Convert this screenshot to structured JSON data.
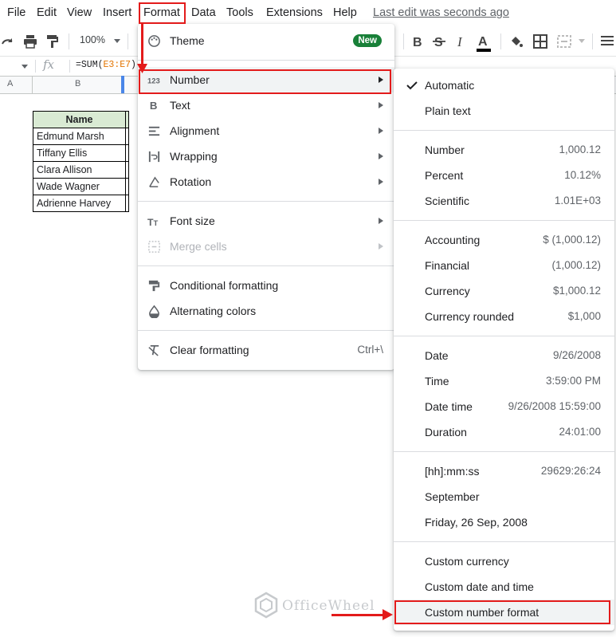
{
  "menubar": {
    "items": [
      "File",
      "Edit",
      "View",
      "Insert",
      "Format",
      "Data",
      "Tools",
      "Extensions",
      "Help"
    ],
    "last_edit": "Last edit was seconds ago"
  },
  "toolbar": {
    "zoom": "100%",
    "icons": [
      "redo-icon",
      "print-icon",
      "paint-format-icon",
      "bold-icon",
      "strikethrough-icon",
      "text-color-icon",
      "fill-color-icon",
      "borders-icon",
      "merge-cells-icon",
      "align-icon"
    ]
  },
  "formula_bar": {
    "fx": "fx",
    "prefix": "=SUM(",
    "ref": "E3:E7",
    "suffix": ")"
  },
  "columns": [
    "A",
    "B"
  ],
  "sheet": {
    "header": "Name",
    "rows": [
      "Edmund Marsh",
      "Tiffany Ellis",
      "Clara Allison",
      "Wade Wagner",
      "Adrienne Harvey"
    ]
  },
  "format_menu": {
    "theme": "Theme",
    "theme_badge": "New",
    "number": "Number",
    "text": "Text",
    "alignment": "Alignment",
    "wrapping": "Wrapping",
    "rotation": "Rotation",
    "font_size": "Font size",
    "merge_cells": "Merge cells",
    "conditional_formatting": "Conditional formatting",
    "alternating_colors": "Alternating colors",
    "clear_formatting": "Clear formatting",
    "clear_shortcut": "Ctrl+\\"
  },
  "number_menu": {
    "items": [
      {
        "label": "Automatic",
        "example": ""
      },
      {
        "label": "Plain text",
        "example": ""
      },
      {
        "label": "Number",
        "example": "1,000.12"
      },
      {
        "label": "Percent",
        "example": "10.12%"
      },
      {
        "label": "Scientific",
        "example": "1.01E+03"
      },
      {
        "label": "Accounting",
        "example": "$ (1,000.12)"
      },
      {
        "label": "Financial",
        "example": "(1,000.12)"
      },
      {
        "label": "Currency",
        "example": "$1,000.12"
      },
      {
        "label": "Currency rounded",
        "example": "$1,000"
      },
      {
        "label": "Date",
        "example": "9/26/2008"
      },
      {
        "label": "Time",
        "example": "3:59:00 PM"
      },
      {
        "label": "Date time",
        "example": "9/26/2008 15:59:00"
      },
      {
        "label": "Duration",
        "example": "24:01:00"
      },
      {
        "label": "[hh]:mm:ss",
        "example": "29629:26:24"
      },
      {
        "label": "September",
        "example": ""
      },
      {
        "label": "Friday, 26 Sep, 2008",
        "example": ""
      },
      {
        "label": "Custom currency",
        "example": ""
      },
      {
        "label": "Custom date and time",
        "example": ""
      },
      {
        "label": "Custom number format",
        "example": ""
      }
    ]
  },
  "watermark": "OfficeWheel",
  "colors": {
    "accent_red": "#e31b1b",
    "badge_green": "#188038",
    "header_fill": "#d9ead3",
    "selection_blue": "#4a86e8"
  }
}
